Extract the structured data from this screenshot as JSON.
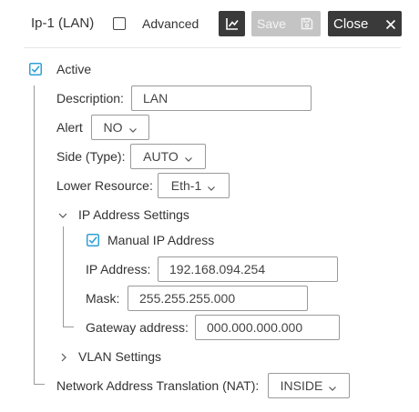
{
  "header": {
    "title": "Ip-1 (LAN)",
    "advanced_label": "Advanced",
    "advanced_checked": false,
    "chart_icon": "chart-line-icon",
    "save_label": "Save",
    "save_icon": "floppy-disk-icon",
    "close_label": "Close",
    "close_icon": "close-icon"
  },
  "form": {
    "active_label": "Active",
    "active_checked": true,
    "description_label": "Description:",
    "description_value": "LAN",
    "alert_label": "Alert",
    "alert_value": "NO",
    "side_label": "Side (Type):",
    "side_value": "AUTO",
    "lower_resource_label": "Lower Resource:",
    "lower_resource_value": "Eth-1",
    "ip_settings": {
      "label": "IP Address Settings",
      "expanded": true,
      "manual_label": "Manual IP Address",
      "manual_checked": true,
      "ip_label": "IP Address:",
      "ip_value": "192.168.094.254",
      "mask_label": "Mask:",
      "mask_value": "255.255.255.000",
      "gateway_label": "Gateway address:",
      "gateway_value": "000.000.000.000"
    },
    "vlan_label": "VLAN Settings",
    "vlan_expanded": false,
    "nat_label": "Network Address Translation (NAT):",
    "nat_value": "INSIDE"
  },
  "colors": {
    "accent": "#2f9fd6",
    "dark_button": "#3a3a3a",
    "disabled_button": "#c4c4c4"
  }
}
